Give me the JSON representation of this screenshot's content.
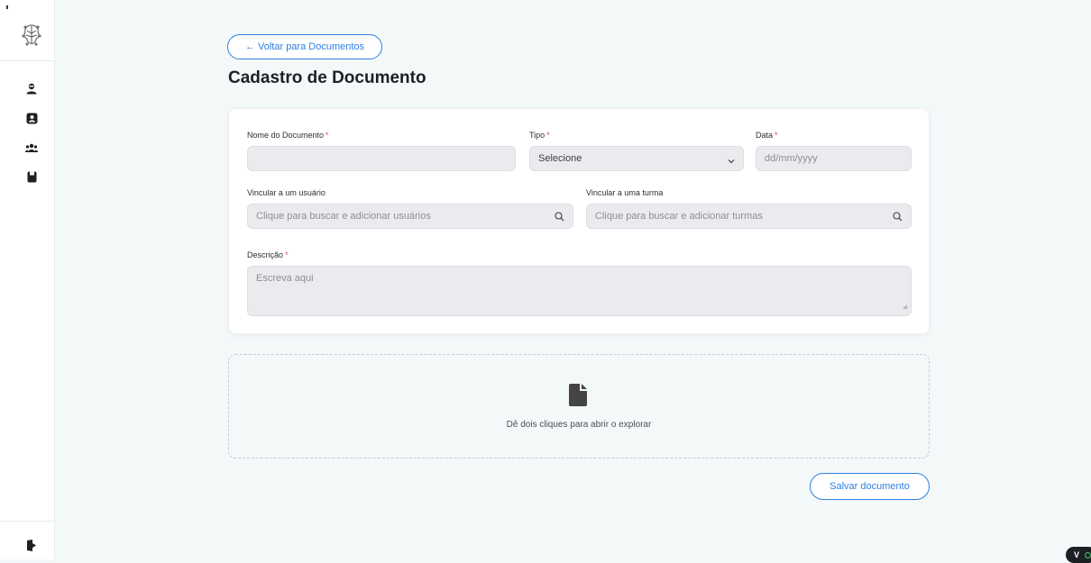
{
  "sidebar": {
    "nav_icons": [
      "user-icon",
      "user-card-icon",
      "group-icon",
      "document-icon"
    ],
    "bottom_icon": "logout-icon"
  },
  "header": {
    "back_label": "← Voltar para Documentos",
    "title": "Cadastro de Documento"
  },
  "form": {
    "name": {
      "label": "Nome do Documento",
      "required": "*",
      "value": ""
    },
    "type": {
      "label": "Tipo",
      "required": "*",
      "selected": "Selecione"
    },
    "date": {
      "label": "Data",
      "required": "*",
      "placeholder": "dd/mm/yyyy"
    },
    "link_user": {
      "label": "Vincular a um usuário",
      "placeholder": "Clique para buscar e adicionar usuários"
    },
    "link_class": {
      "label": "Vincular a uma turma",
      "placeholder": "Clique para buscar e adicionar turmas"
    },
    "description": {
      "label": "Descrição",
      "required": "*",
      "placeholder": "Escreva aqui"
    }
  },
  "dropzone": {
    "text": "Dê dois cliques para abrir o explorar"
  },
  "actions": {
    "save_label": "Salvar documento"
  },
  "badge": {
    "text": "V"
  },
  "colors": {
    "accent": "#2f7fe0",
    "background": "#f3f8f9",
    "field_bg": "#ebebef",
    "required": "#e04a4a"
  }
}
